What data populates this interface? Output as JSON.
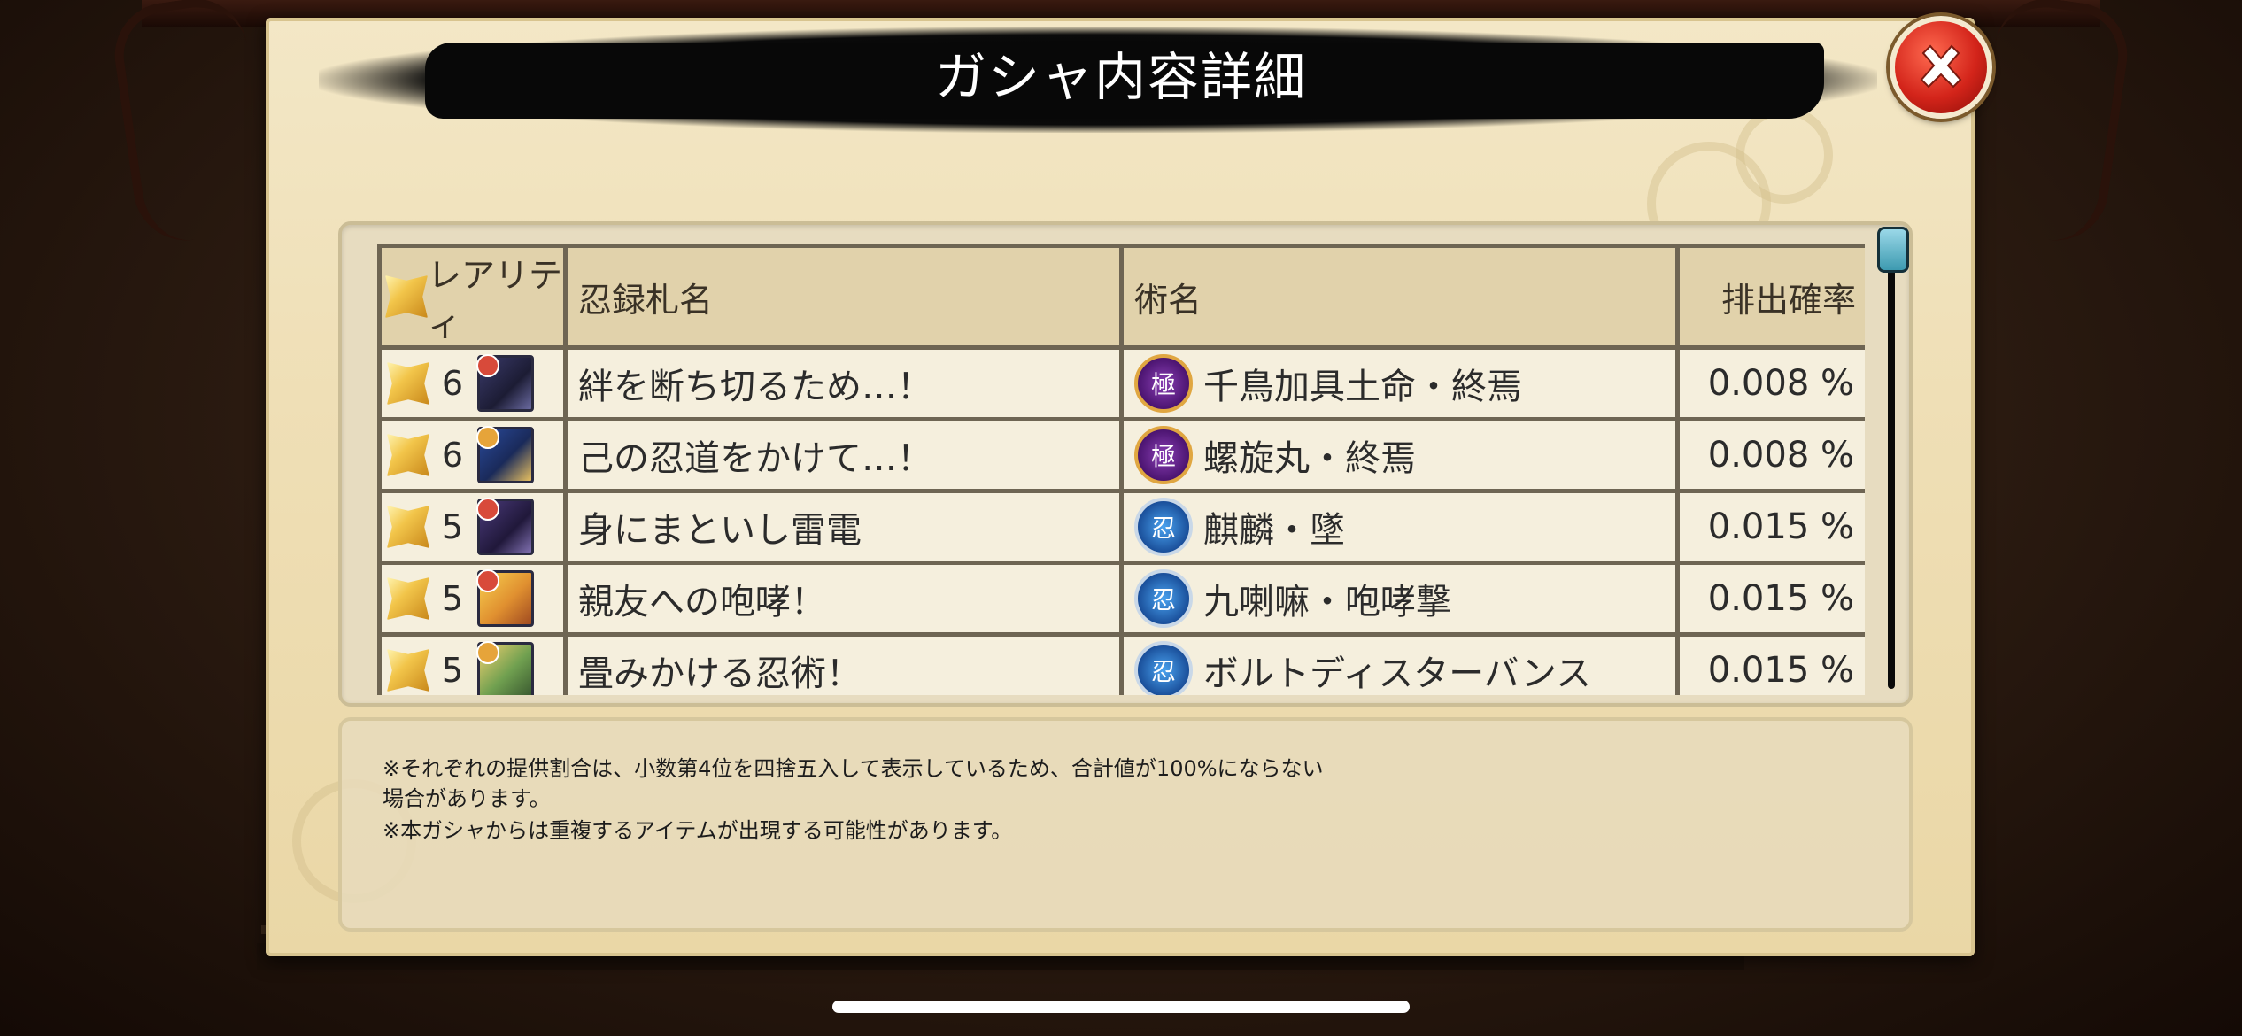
{
  "dialog": {
    "title": "ガシャ内容詳細",
    "close_icon": "close-x-icon"
  },
  "table": {
    "headers": {
      "rarity": "レアリティ",
      "card_name": "忍録札名",
      "jutsu_name": "術名",
      "rate": "排出確率"
    },
    "rows": [
      {
        "rarity": "6",
        "card_name": "絆を断ち切るため…！",
        "jutsu_icon": "kanji-kiwami-icon",
        "jutsu_icon_char": "極",
        "jutsu_color": "purple",
        "jutsu_name": "千鳥加具土命・終焉",
        "rate": "0.008 %"
      },
      {
        "rarity": "6",
        "card_name": "己の忍道をかけて…！",
        "jutsu_icon": "kanji-kiwami-icon",
        "jutsu_icon_char": "極",
        "jutsu_color": "purple",
        "jutsu_name": "螺旋丸・終焉",
        "rate": "0.008 %"
      },
      {
        "rarity": "5",
        "card_name": "身にまといし雷電",
        "jutsu_icon": "kanji-shinobi-icon",
        "jutsu_icon_char": "忍",
        "jutsu_color": "blue",
        "jutsu_name": "麒麟・墜",
        "rate": "0.015 %"
      },
      {
        "rarity": "5",
        "card_name": "親友への咆哮！",
        "jutsu_icon": "kanji-shinobi-icon",
        "jutsu_icon_char": "忍",
        "jutsu_color": "blue",
        "jutsu_name": "九喇嘛・咆哮撃",
        "rate": "0.015 %"
      },
      {
        "rarity": "5",
        "card_name": "畳みかける忍術！",
        "jutsu_icon": "kanji-shinobi-icon",
        "jutsu_icon_char": "忍",
        "jutsu_color": "blue",
        "jutsu_name": "ボルトディスターバンス",
        "rate": "0.015 %"
      }
    ]
  },
  "notes": {
    "line1": "※それぞれの提供割合は、小数第4位を四捨五入して表示しているため、合計値が100%にならない",
    "line2": "場合があります。",
    "line3": "※本ガシャからは重複するアイテムが出現する可能性があります。"
  },
  "colors": {
    "purple_icon": "#4b1470",
    "blue_icon": "#1a4f9a",
    "close_button": "#d3241a"
  }
}
